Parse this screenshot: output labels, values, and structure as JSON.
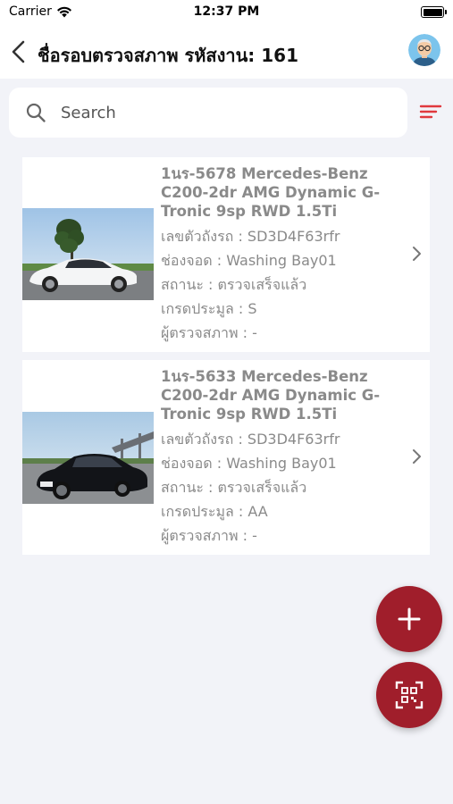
{
  "status_bar": {
    "carrier": "Carrier",
    "time": "12:37 PM"
  },
  "nav": {
    "title": "ชื่อรอบตรวจสภาพ รหัสงาน: 161",
    "back_icon": "chevron-left-icon",
    "avatar": "user-avatar"
  },
  "search": {
    "placeholder": "Search",
    "value": "",
    "icon": "search-icon"
  },
  "filter": {
    "icon": "filter-lines-icon",
    "color": "#e0393e"
  },
  "cars": [
    {
      "name": "1นร-5678 Mercedes-Benz C200-2dr AMG Dynamic G-Tronic 9sp RWD 1.5Ti",
      "vin": "เลขตัวถังรถ : SD3D4F63rfr",
      "bay": "ช่องจอด : Washing Bay01",
      "status": "สถานะ : ตรวจเสร็จแล้ว",
      "grade": "เกรดประมูล : S",
      "inspector": "ผู้ตรวจสภาพ : -",
      "car_color": "white"
    },
    {
      "name": "1นร-5633 Mercedes-Benz C200-2dr AMG Dynamic G-Tronic 9sp RWD 1.5Ti",
      "vin": "เลขตัวถังรถ : SD3D4F63rfr",
      "bay": "ช่องจอด : Washing Bay01",
      "status": "สถานะ : ตรวจเสร็จแล้ว",
      "grade": "เกรดประมูล : AA",
      "inspector": "ผู้ตรวจสภาพ : -",
      "car_color": "black"
    }
  ],
  "fabs": {
    "add_icon": "plus-icon",
    "scan_icon": "qr-scan-icon",
    "color": "#a01e2b"
  }
}
